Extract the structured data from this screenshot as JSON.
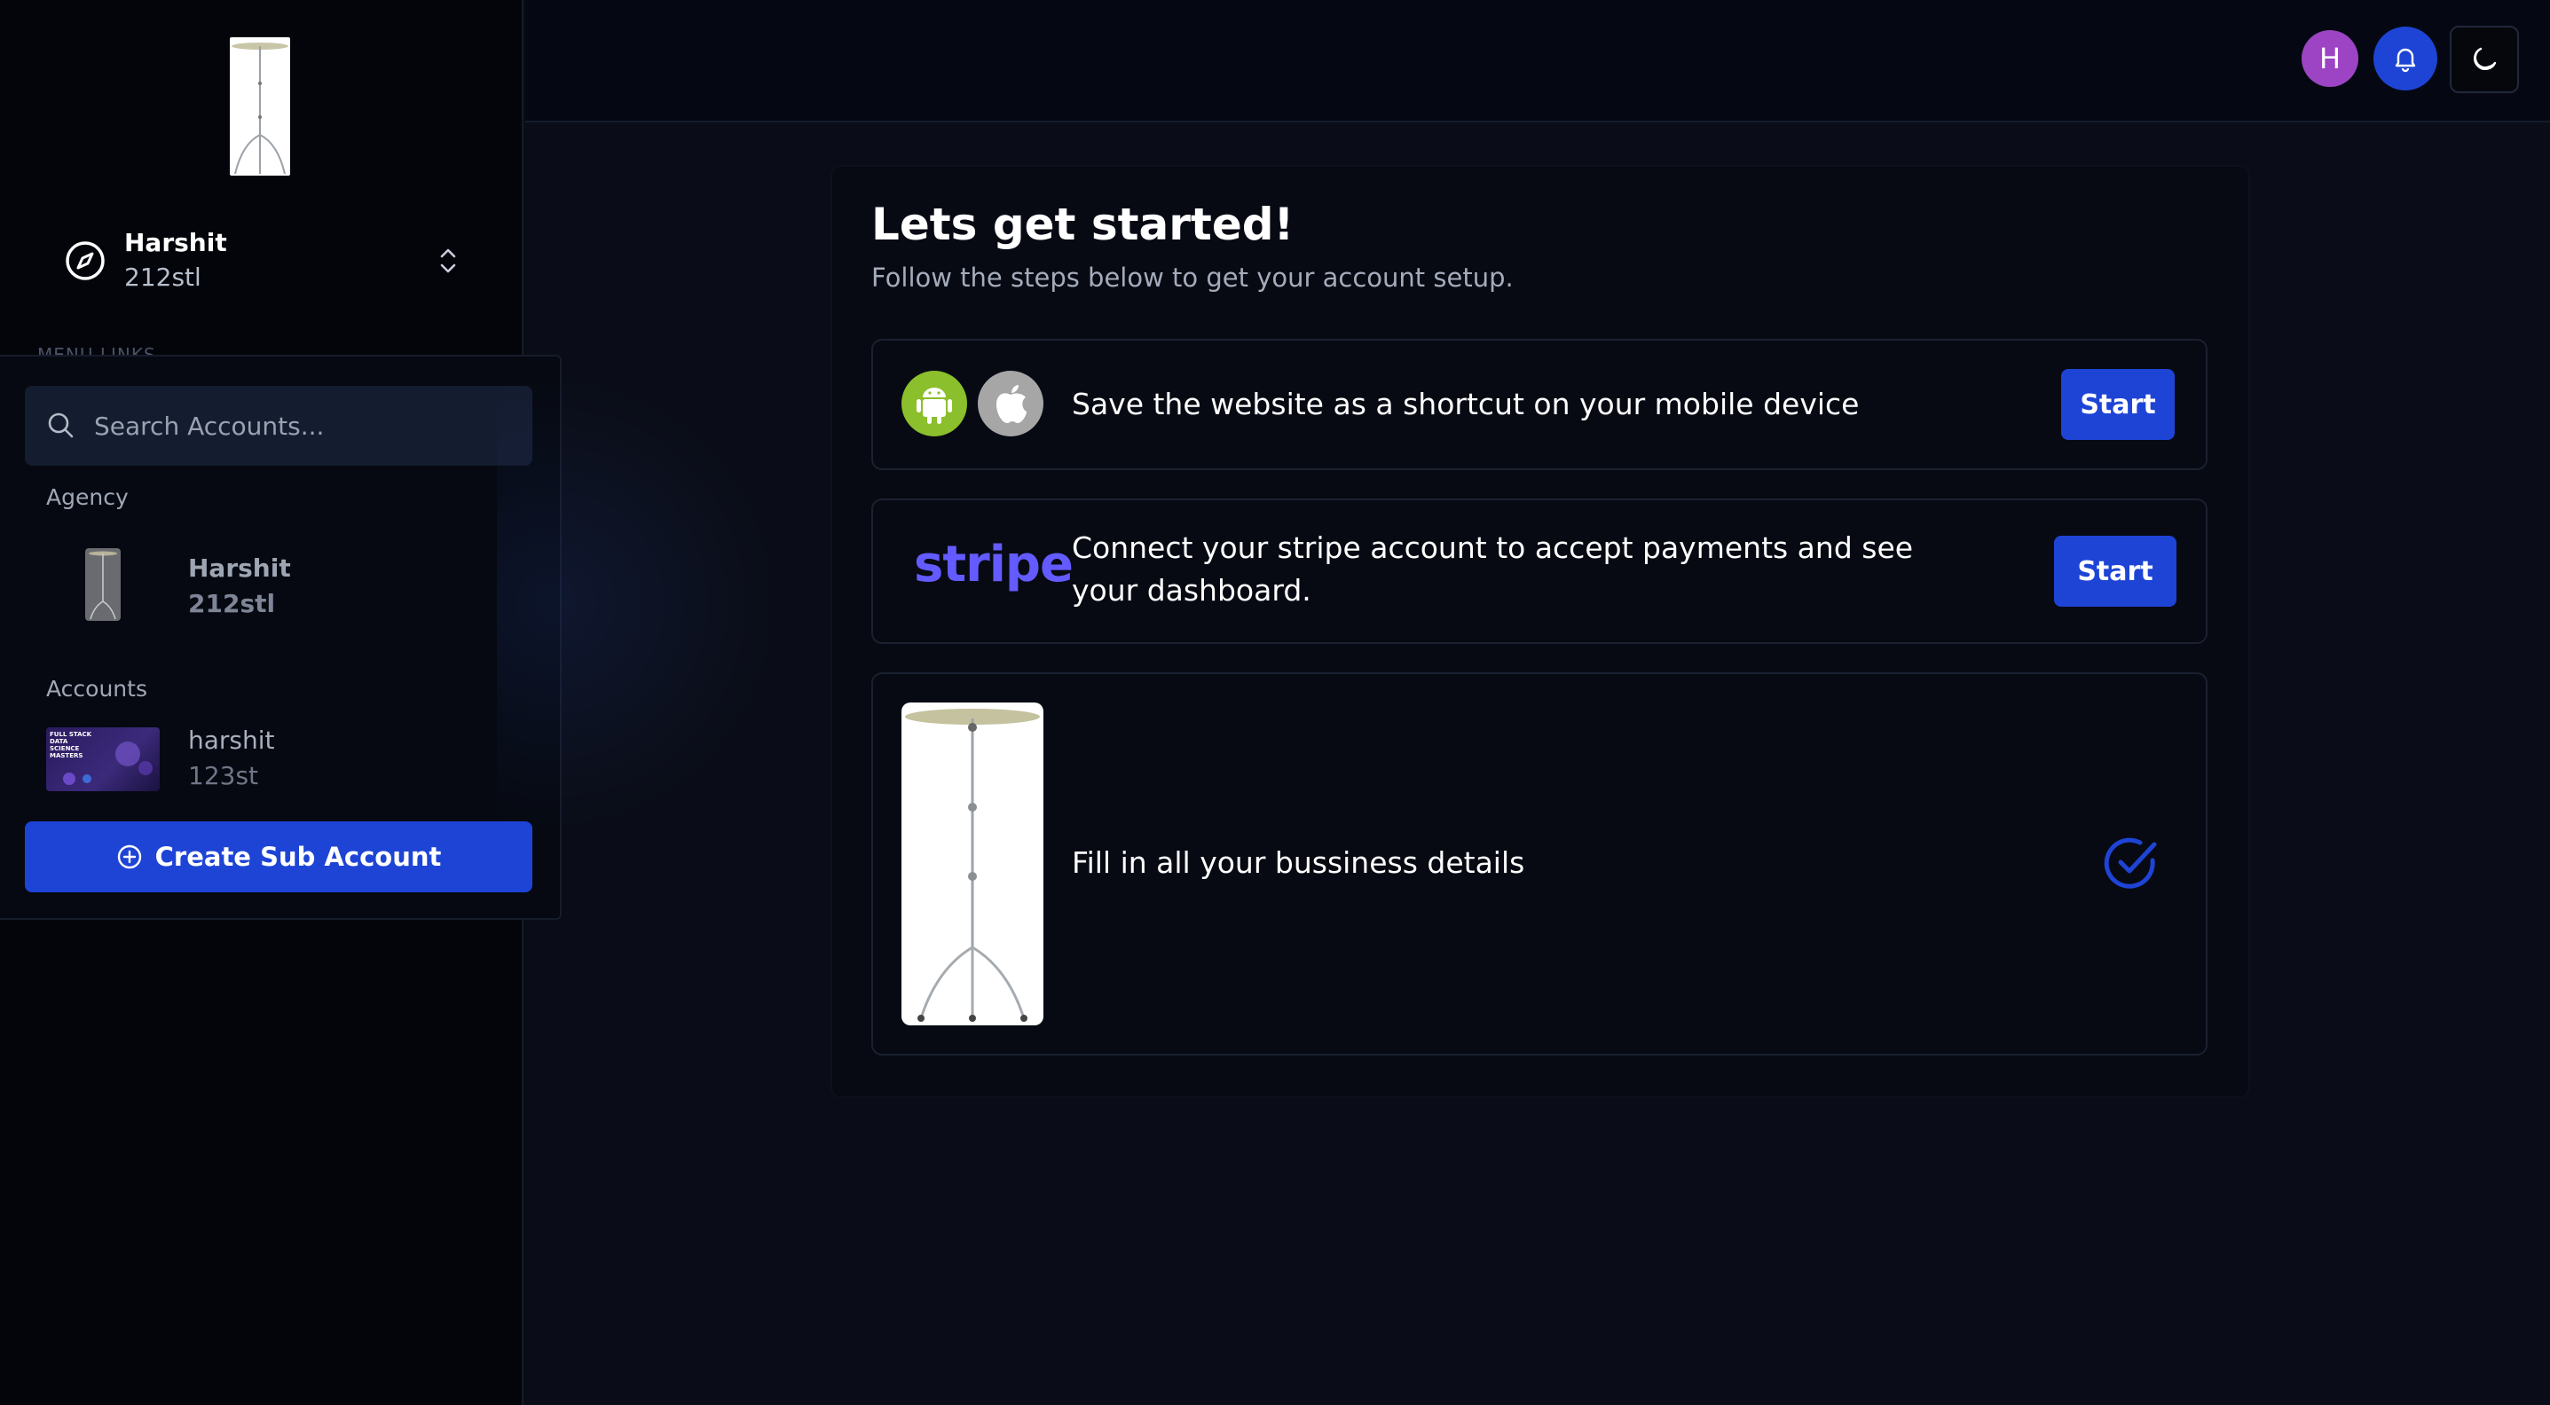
{
  "sidebar": {
    "account_switcher": {
      "name": "Harshit",
      "sub": "212stl"
    },
    "menu_links_ghost": "MENU LINKS"
  },
  "dropdown": {
    "search_placeholder": "Search Accounts...",
    "agency_label": "Agency",
    "agency": {
      "name": "Harshit",
      "sub": "212stl"
    },
    "accounts_label": "Accounts",
    "accounts": [
      {
        "name": "harshit",
        "sub": "123st"
      }
    ],
    "thumb_text": "FULL STACK DATA SCIENCE MASTERS",
    "create_label": "Create Sub Account"
  },
  "topbar": {
    "avatar_initial": "H"
  },
  "main": {
    "title": "Lets get started!",
    "subtitle": "Follow the steps below to get your account setup.",
    "steps": [
      {
        "text": "Save the website as a shortcut on your mobile device",
        "button": "Start"
      },
      {
        "text": "Connect your stripe account to accept payments and see your dashboard.",
        "button": "Start",
        "logo": "stripe"
      },
      {
        "text": "Fill in all your bussiness details",
        "status": "completed"
      }
    ]
  },
  "colors": {
    "accent": "#1e44d6",
    "android": "#8bbf2c",
    "apple": "#a6a6a6",
    "stripe": "#635bff",
    "avatar": "#9c44c4"
  }
}
